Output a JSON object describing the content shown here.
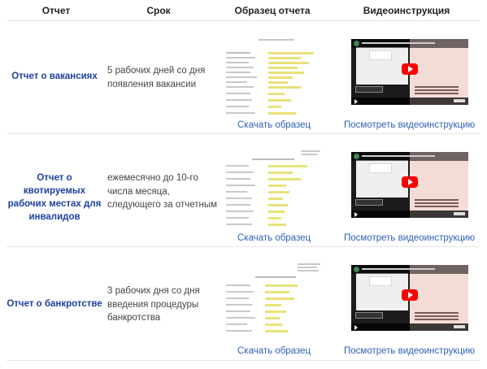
{
  "header": {
    "col_report": "Отчет",
    "col_term": "Срок",
    "col_sample": "Образец отчета",
    "col_video": "Видеоинструкция"
  },
  "rows": [
    {
      "name": "Отчет о вакансиях",
      "term": "5 рабочих дней со дня появления вакансии",
      "download_label": "Скачать образец",
      "video_label": "Посмотреть видеоинструкцию"
    },
    {
      "name": "Отчет о квотируемых рабочих местах для инвалидов",
      "term": "ежемесячно до 10-го числа месяца, следующего за отчетным",
      "download_label": "Скачать образец",
      "video_label": "Посмотреть видеоинструкцию"
    },
    {
      "name": "Отчет о банкротстве",
      "term": "3 рабочих дня со дня введения процедуры банкротства",
      "download_label": "Скачать образец",
      "video_label": "Посмотреть видеоинструкцию"
    }
  ],
  "colors": {
    "link": "#2e5fb8",
    "report_name": "#1c3fa0",
    "highlight": "#e8e27a",
    "youtube_red": "#ff0000"
  }
}
